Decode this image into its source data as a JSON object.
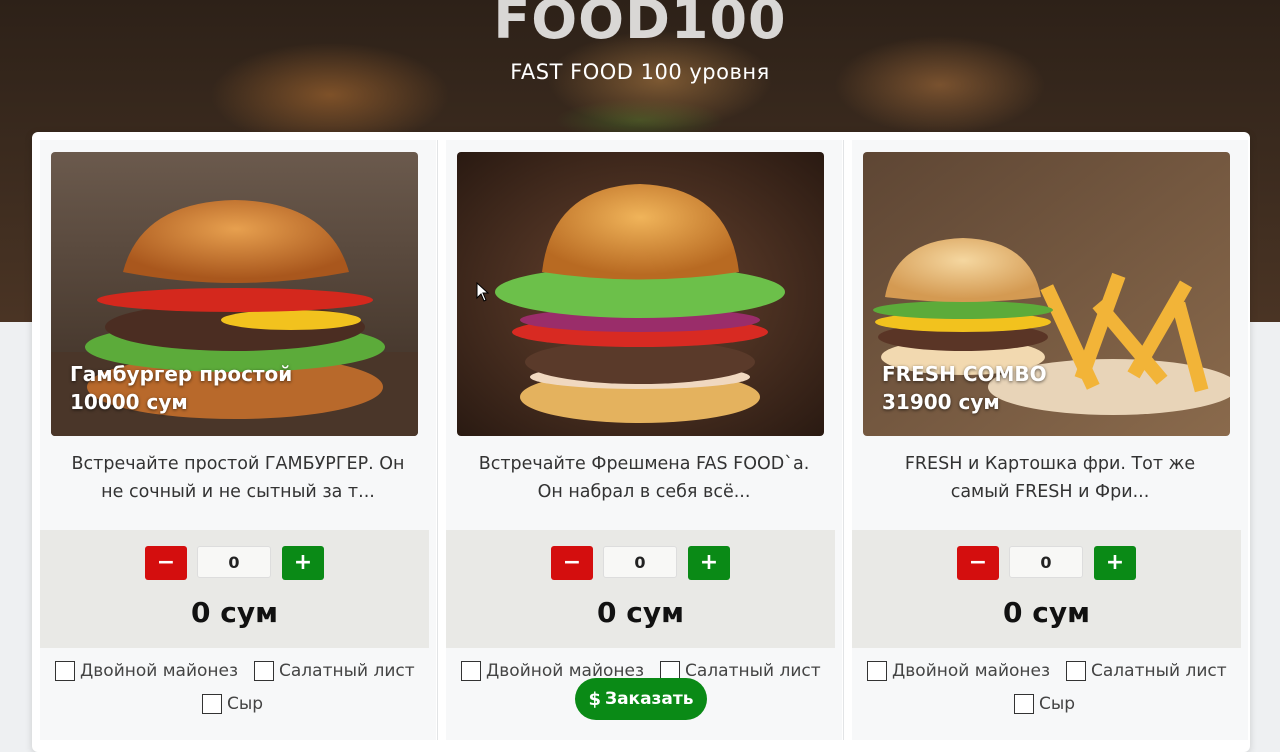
{
  "header": {
    "brand": "FOOD100",
    "tagline": "FAST FOOD 100 уровня"
  },
  "products": [
    {
      "name": "Гамбургер простой",
      "price": "10000 сум",
      "description": "Встречайте простой ГАМБУРГЕР. Он не сочный и не сытный за т...",
      "quantity": "0",
      "total": "0 сум",
      "minus_label": "−",
      "plus_label": "+",
      "options": [
        "Двойной майонез",
        "Салатный лист",
        "Сыр"
      ]
    },
    {
      "name": "",
      "price": "",
      "description": "Встречайте Фрешмена FAS FOOD`а. Он набрал в себя всё...",
      "quantity": "0",
      "total": "0 сум",
      "minus_label": "−",
      "plus_label": "+",
      "options": [
        "Двойной майонез",
        "Салатный лист"
      ]
    },
    {
      "name": "FRESH COMBO",
      "price": "31900 сум",
      "description": "FRESH и Картошка фри. Тот же самый FRESH и Фри...",
      "quantity": "0",
      "total": "0 сум",
      "minus_label": "−",
      "plus_label": "+",
      "options": [
        "Двойной майонез",
        "Салатный лист",
        "Сыр"
      ]
    }
  ],
  "order_button": {
    "label": "Заказать",
    "icon": "dollar-icon"
  },
  "colors": {
    "minus": "#d40e0e",
    "plus": "#0a8a16",
    "order": "#0a8a16"
  }
}
